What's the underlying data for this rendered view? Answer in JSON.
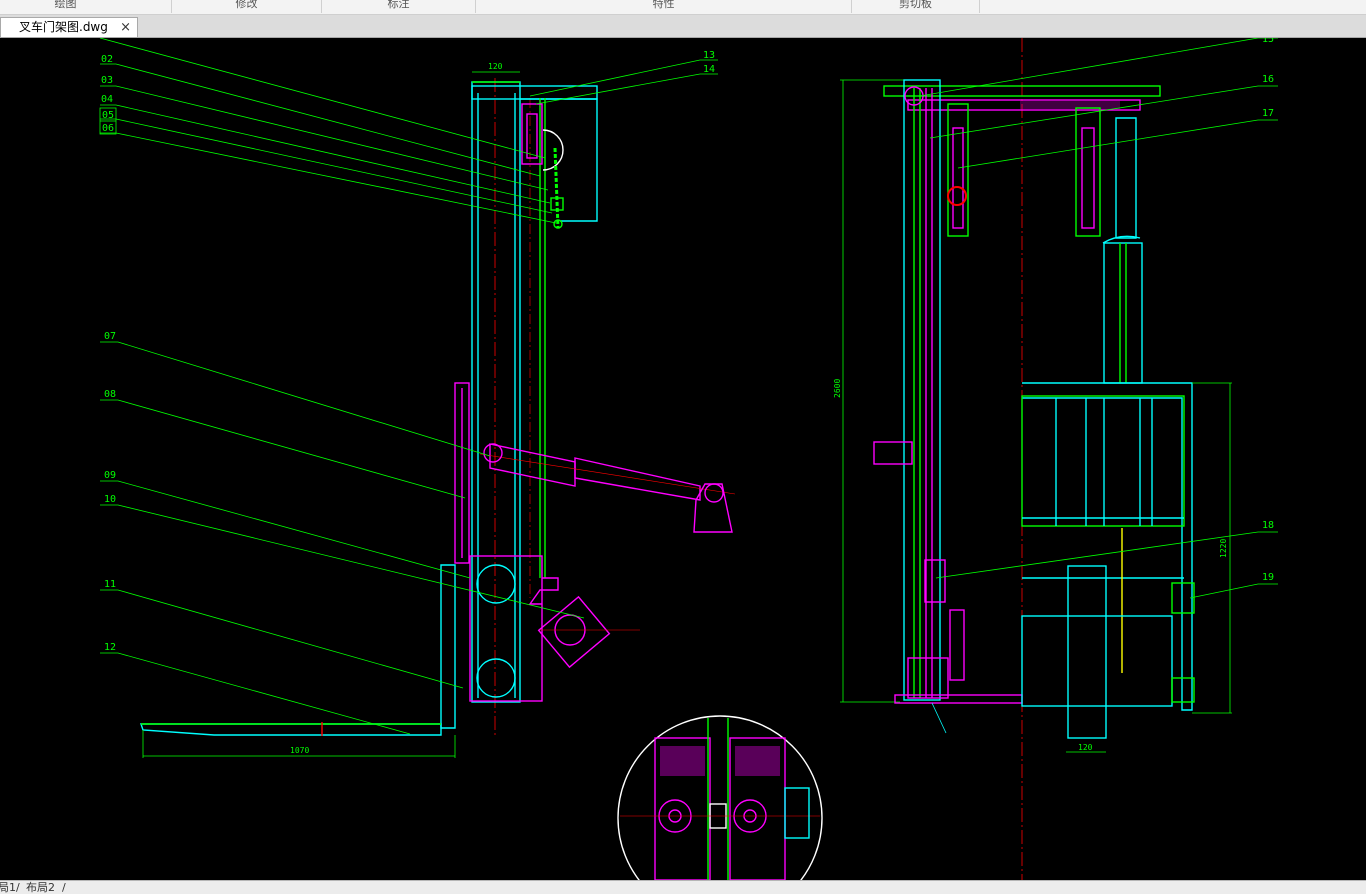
{
  "ribbon": {
    "groups": [
      "绘图",
      "修改",
      "标注",
      "特性",
      "剪切板"
    ]
  },
  "tabs": [
    {
      "label": "叉车门架图.dwg",
      "close": "×"
    }
  ],
  "drawing": {
    "leaders_left": [
      "02",
      "03",
      "04",
      "05",
      "06",
      "07",
      "08",
      "09",
      "10",
      "11",
      "12"
    ],
    "leaders_right": [
      "13",
      "14",
      "15",
      "16",
      "17",
      "18",
      "19"
    ],
    "dims": {
      "top_width": "120",
      "fork_length": "1070",
      "height": "2600",
      "carriage_height": "1220",
      "bottom_width": "120"
    }
  },
  "layout_tabs": [
    "局1",
    "布局2"
  ],
  "colors": {
    "background": "#000000",
    "cyan": "#00ffff",
    "green": "#00ff00",
    "magenta": "#ff00ff",
    "red": "#ff0000",
    "white": "#ffffff"
  }
}
